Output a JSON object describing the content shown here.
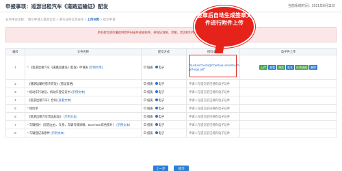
{
  "header": {
    "title": "申报事项：巡游出租汽车《道路运输证》配发",
    "date": "当前系统时间：2021年8月11日"
  },
  "steps": {
    "pre": "业务申办流程：  填写申请人基本信息 > 填写业务信息表单 > ",
    "current": "上传材料",
    "post": " > 提交申请"
  },
  "notice": {
    "line1": "所有材料请尽量提供原件扫描件或拍照件，并保证清晰、完整，若因材料不清晰导致退件，责任由申请人自行承担"
  },
  "table": {
    "headers": [
      "编号",
      "文件名称",
      "提交方式",
      "材料文件",
      "电子件上传"
    ],
    "rows": [
      {
        "num": "1",
        "req": "*",
        "name": "《巡游出租汽车《道路运输证》配发》申请表",
        "sample": "(示例文本)",
        "option1": "纸质",
        "option2": "电子",
        "opt1_on": false,
        "opt2_on": true,
        "file": "\"XuxhaoChuZuQiCheDaoLuYunShuZhe_202108111427011881230.jpg-pdf-sign.pdf\"",
        "actions": [
          "上传",
          "查看",
          "预览",
          "签名",
          "在线填报",
          "删除"
        ]
      },
      {
        "num": "2",
        "req": "",
        "name": "《道路运输经营许可证》(营运资格)",
        "sample": "",
        "option1": "纸质",
        "option2": "电子",
        "opt1_on": false,
        "opt2_on": true,
        "file": "申请人在提交前已拥有电子证件",
        "actions": []
      },
      {
        "num": "3",
        "req": "*",
        "name": "机动车行驶证、机动车登记证书",
        "sample": "(示例文本)",
        "option1": "纸质",
        "option2": "电子",
        "opt1_on": false,
        "opt2_on": true,
        "file": "申请人在提交前已拥有电子证件",
        "actions": []
      },
      {
        "num": "4",
        "req": "",
        "name": "《巡游出租汽车》合同",
        "sample": "(查看文本)",
        "option1": "纸质",
        "option2": "电子",
        "opt1_on": false,
        "opt2_on": true,
        "file": "申请人在提交前已拥有电子证件",
        "actions": []
      },
      {
        "num": "5",
        "req": "*",
        "name": "保险单",
        "sample": "",
        "option1": "纸质",
        "option2": "电子",
        "opt1_on": false,
        "opt2_on": true,
        "file": "申请人在提交前已拥有电子证件",
        "actions": []
      },
      {
        "num": "6",
        "req": "",
        "name": "《巡游出租汽车营运标准》",
        "sample": "(示例文本)",
        "option1": "纸质",
        "option2": "电子",
        "opt1_on": false,
        "opt2_on": true,
        "file": "申请人在提交前已拥有电子证件",
        "actions": []
      },
      {
        "num": "7",
        "req": "*",
        "name": "车辆照片（前后左右、车身、车辆号牌清晰，5cm×5cm彩色照片）",
        "sample": "(示例文本)",
        "option1": "纸质",
        "option2": "电子",
        "opt1_on": false,
        "opt2_on": true,
        "file": "申请人在提交前已拥有电子证件",
        "actions": []
      },
      {
        "num": "8",
        "req": "*",
        "name": "车辆登记表原件",
        "sample": "(示例文本)",
        "option1": "纸质",
        "option2": "电子",
        "opt1_on": false,
        "opt2_on": true,
        "file": "申请人在提交前已拥有电子证件",
        "actions": []
      }
    ]
  },
  "annotation": {
    "text": "签章后自动生成签章文件进行附件上传"
  },
  "buttons": {
    "prev": "上一步",
    "next": "提交"
  }
}
